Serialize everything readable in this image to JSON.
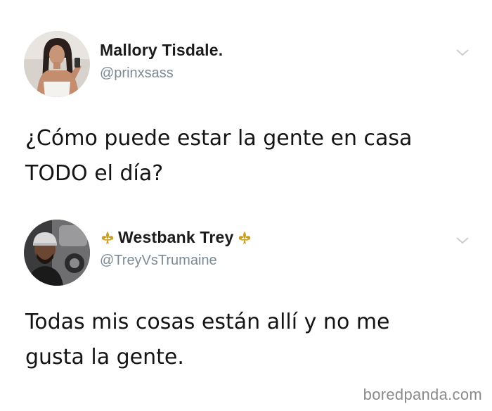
{
  "tweets": [
    {
      "display_name": "Mallory Tisdale.",
      "handle": "@prinxsass",
      "text": "¿Cómo puede estar la gente en casa\nTODO el día?",
      "avatar_icon": "profile-photo"
    },
    {
      "display_name": "Westbank Trey",
      "handle": "@TreyVsTrumaine",
      "text": "Todas mis cosas están allí y no me\ngusta la gente.",
      "avatar_icon": "profile-photo",
      "name_decoration_icon": "fleur-de-lis-icon"
    }
  ],
  "watermark": "boredpanda.com",
  "colors": {
    "handle": "#7d8a95",
    "chevron": "#c8ced3",
    "fleur": "#c9a22a",
    "text": "#141414"
  }
}
